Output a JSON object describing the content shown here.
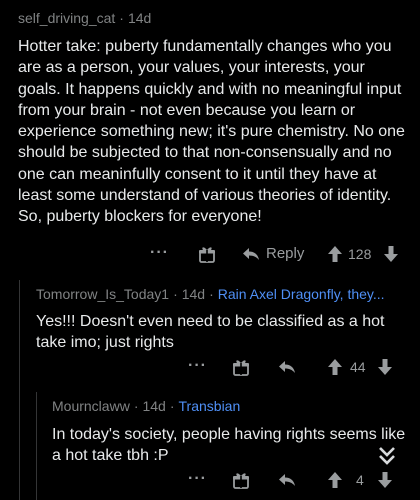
{
  "comments": [
    {
      "username": "self_driving_cat",
      "age": "14d",
      "body": "Hotter take: puberty fundamentally changes who you are as a person, your values, your interests, your goals. It happens quickly and with no meaningful input from your brain - not even because you learn or experience something new; it's pure chemistry. No one should be subjected to that non-consensually and no one can meaninfully consent to it until they have at least some understand of various theories of identity. So, puberty blockers for everyone!",
      "reply_label": "Reply",
      "score": "128"
    },
    {
      "username": "Tomorrow_Is_Today1",
      "age": "14d",
      "flair": "Rain Axel Dragonfly, they...",
      "body": "Yes!!! Doesn't even need to be classified as a hot take imo; just rights",
      "score": "44"
    },
    {
      "username": "Mournclaww",
      "age": "14d",
      "flair": "Transbian",
      "body": "In today's society, people having rights seems like a hot take tbh :P",
      "score": "4"
    }
  ],
  "icons": {
    "more": "more-dots-icon",
    "award": "award-gift-icon",
    "reply": "reply-arrow-icon",
    "upvote": "upvote-arrow-icon",
    "downvote": "downvote-arrow-icon",
    "collapse": "double-chevron-down-icon"
  },
  "colors": {
    "background": "#000000",
    "text": "#e8eaeb",
    "meta": "#818384",
    "flair": "#4f8ff5",
    "thread_line": "#343536"
  }
}
